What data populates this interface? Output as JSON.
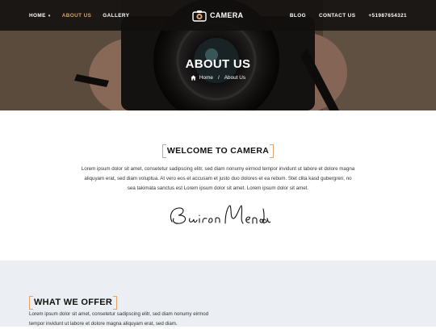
{
  "nav": {
    "left": [
      "HOME",
      "ABOUT US",
      "GALLERY"
    ],
    "home_caret": "▾",
    "brand": "CAMERA",
    "right": [
      "BLOG",
      "CONTACT US",
      "+51987654321"
    ]
  },
  "hero": {
    "title": "ABOUT US",
    "breadcrumb_home": "Home",
    "breadcrumb_sep": "/",
    "breadcrumb_current": "About Us"
  },
  "welcome": {
    "title": "WELCOME TO CAMERA",
    "text": "Lorem ipsum dolor sit amet, consetetur sadipscing elitr, sed diam nonumy eirmod tempor invidunt ut labore et dolore magna aliquyam erat, sed diam voluptua. At vero eos et accusam et justo duo dolores et ea rebum. Stet clita kasd gubergren, no sea takimata sanctus est Lorem ipsum dolor sit amet. Lorem ipsum dolor sit amet.",
    "signature": "Bairon Mendoza"
  },
  "offer": {
    "title": "WHAT WE OFFER",
    "text": "Lorem ipsum dolor sit amet, consetetur sadipscing elitr, sed diam nonumy eirmod tempor invidunt ut labore et dolore magna aliquyam erat, sed diam."
  },
  "colors": {
    "accent": "#e0a369",
    "topbar": "#121010",
    "section_bg": "#ebeef2"
  }
}
